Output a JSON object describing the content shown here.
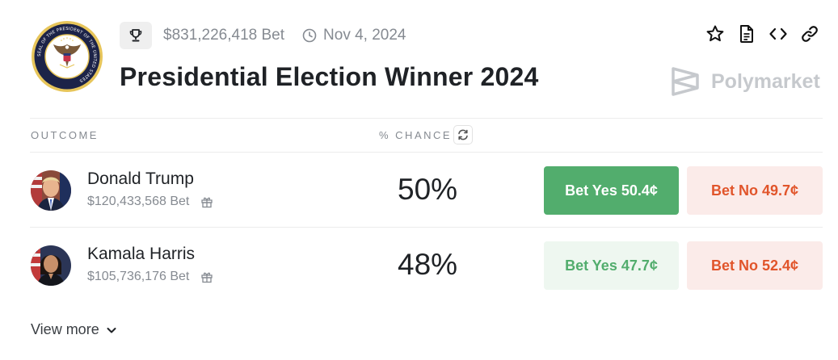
{
  "market": {
    "volume": "$831,226,418 Bet",
    "date": "Nov 4, 2024",
    "title": "Presidential Election Winner 2024",
    "brand": "Polymarket"
  },
  "seal": {
    "top_text": "SEAL OF THE PRESIDENT OF THE UNITED STATES",
    "colors": {
      "ring": "#e7c55a",
      "field": "#1c2348",
      "eagle": "#7a5a3a"
    }
  },
  "table": {
    "outcome_header": "OUTCOME",
    "chance_header": "% CHANCE"
  },
  "outcomes": [
    {
      "name": "Donald Trump",
      "volume": "$120,433,568 Bet",
      "chance": "50%",
      "yes_label": "Bet Yes 50.4¢",
      "no_label": "Bet No 49.7¢"
    },
    {
      "name": "Kamala Harris",
      "volume": "$105,736,176 Bet",
      "chance": "48%",
      "yes_label": "Bet Yes 47.7¢",
      "no_label": "Bet No 52.4¢"
    }
  ],
  "footer": {
    "view_more": "View more"
  },
  "icons": [
    "trophy-icon",
    "clock-icon",
    "star-icon",
    "document-icon",
    "embed-code-icon",
    "link-icon",
    "polymarket-logo-icon",
    "refresh-icon",
    "gift-icon",
    "chevron-down-icon"
  ],
  "colors": {
    "yes_active_bg": "#52ad6d",
    "yes_soft_bg": "#eef7f0",
    "no_bg": "#fbebe9",
    "no_text": "#e1552b",
    "muted_text": "#858a91"
  }
}
